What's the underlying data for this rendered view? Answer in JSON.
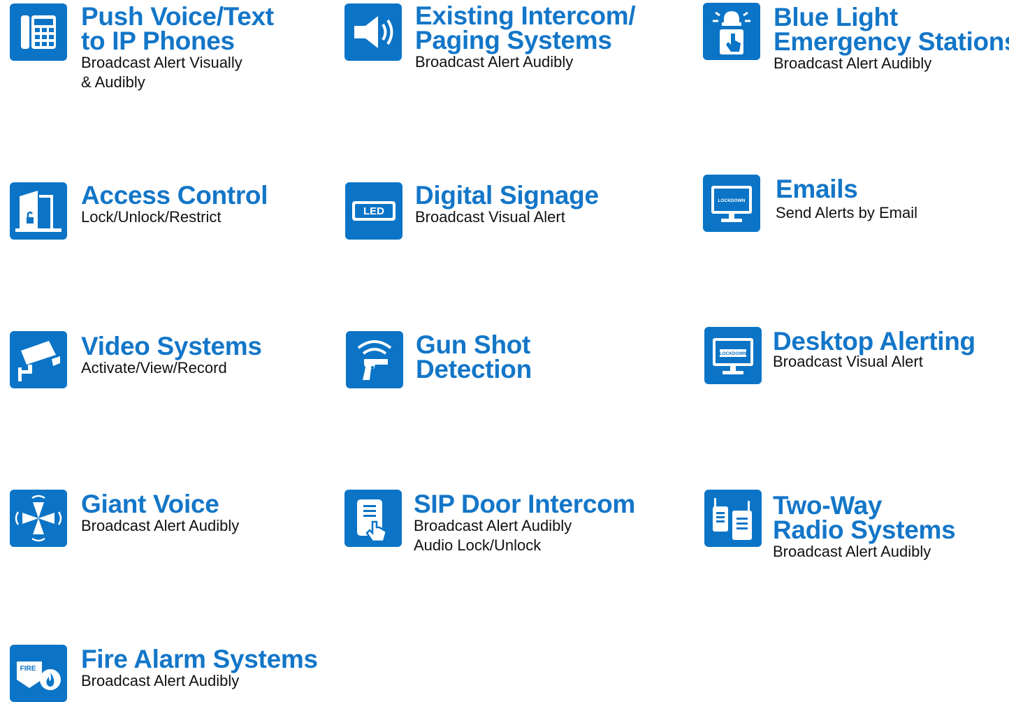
{
  "colors": {
    "brand_blue": "#0b74c6",
    "title_blue": "#1376c8",
    "text": "#111111"
  },
  "items": [
    {
      "icon": "ip-phone-icon",
      "title": [
        "Push Voice/Text",
        "to IP Phones"
      ],
      "subtitle": [
        "Broadcast Alert Visually",
        "& Audibly"
      ]
    },
    {
      "icon": "speaker-icon",
      "title": [
        "Existing Intercom/",
        "Paging Systems"
      ],
      "subtitle": [
        "Broadcast Alert Audibly"
      ]
    },
    {
      "icon": "blue-light-station-icon",
      "title": [
        "Blue Light",
        "Emergency Stations"
      ],
      "subtitle": [
        "Broadcast Alert Audibly"
      ]
    },
    {
      "icon": "door-lock-icon",
      "title": [
        "Access Control"
      ],
      "subtitle": [
        "Lock/Unlock/Restrict"
      ]
    },
    {
      "icon": "led-sign-icon",
      "led_text": "LED",
      "title": [
        "Digital Signage"
      ],
      "subtitle": [
        "Broadcast Visual Alert"
      ]
    },
    {
      "icon": "email-monitor-icon",
      "screen_text": "LOCKDOWN",
      "title": [
        "Emails"
      ],
      "subtitle": [
        "Send Alerts by Email"
      ]
    },
    {
      "icon": "security-camera-icon",
      "title": [
        "Video Systems"
      ],
      "subtitle": [
        "Activate/View/Record"
      ]
    },
    {
      "icon": "gun-detection-icon",
      "title": [
        "Gun Shot",
        "Detection"
      ],
      "subtitle": []
    },
    {
      "icon": "desktop-monitor-icon",
      "screen_text": "LOCKDOWN",
      "title": [
        "Desktop Alerting"
      ],
      "subtitle": [
        "Broadcast Visual Alert"
      ]
    },
    {
      "icon": "giant-voice-icon",
      "title": [
        "Giant Voice"
      ],
      "subtitle": [
        "Broadcast Alert Audibly"
      ]
    },
    {
      "icon": "door-intercom-icon",
      "title": [
        "SIP Door Intercom"
      ],
      "subtitle": [
        "Broadcast Alert Audibly",
        "Audio Lock/Unlock"
      ]
    },
    {
      "icon": "two-way-radio-icon",
      "title": [
        "Two-Way",
        "Radio Systems"
      ],
      "subtitle": [
        "Broadcast Alert Audibly"
      ]
    },
    {
      "icon": "fire-alarm-icon",
      "fire_text": "FIRE",
      "title": [
        "Fire Alarm Systems"
      ],
      "subtitle": [
        "Broadcast Alert Audibly"
      ]
    }
  ]
}
